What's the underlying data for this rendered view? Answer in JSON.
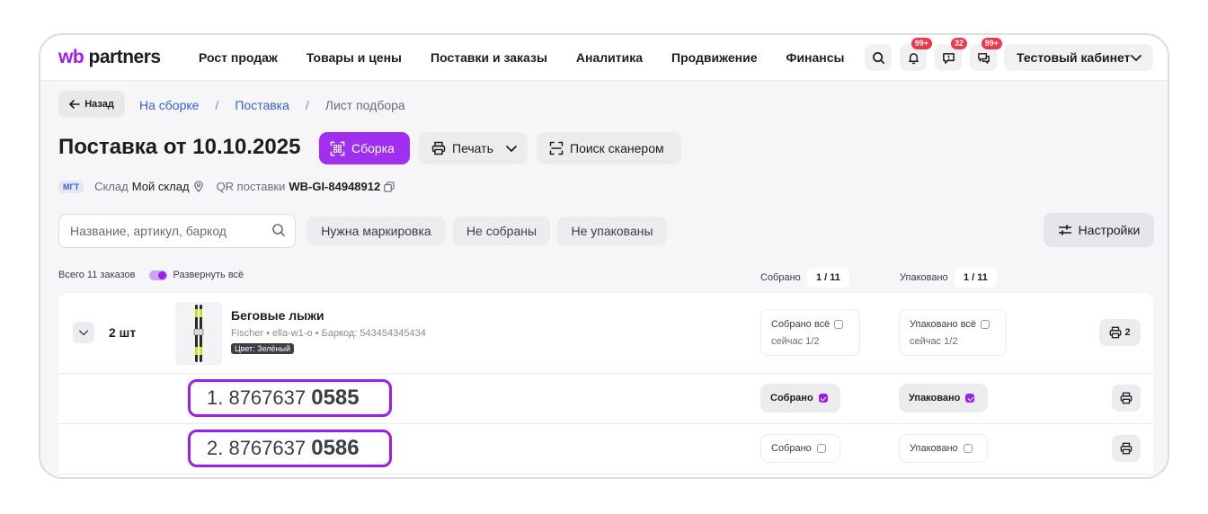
{
  "brand": {
    "wb": "wb",
    "partners": "partners"
  },
  "nav": [
    "Рост продаж",
    "Товары и цены",
    "Поставки и заказы",
    "Аналитика",
    "Продвижение",
    "Финансы"
  ],
  "badges": {
    "notifications": "99+",
    "feedback": "32",
    "chats": "99+"
  },
  "account": {
    "label": "Тестовый кабинет"
  },
  "back_label": "Назад",
  "breadcrumbs": {
    "c1": "На сборке",
    "c2": "Поставка",
    "c3": "Лист подбора",
    "sep": "/"
  },
  "page_title": "Поставка от 10.10.2025",
  "actions": {
    "assembly": "Сборка",
    "print": "Печать",
    "scanner": "Поиск сканером"
  },
  "meta": {
    "tag": "МГТ",
    "warehouse_label": "Склад",
    "warehouse_value": "Мой склад",
    "qr_label": "QR поставки",
    "qr_value": "WB-GI-84948912"
  },
  "search": {
    "placeholder": "Название, артикул, баркод"
  },
  "filters": [
    "Нужна маркировка",
    "Не собраны",
    "Не упакованы"
  ],
  "settings_label": "Настройки",
  "summary": {
    "total": "Всего 11 заказов",
    "expand": "Развернуть всё"
  },
  "counts": {
    "collected_label": "Собрано",
    "collected_value": "1 / 11",
    "packed_label": "Упаковано",
    "packed_value": "1 / 11"
  },
  "product": {
    "qty": "2 шт",
    "name": "Беговые лыжи",
    "sub": "Fischer • ella-w1-o • Баркод: 543454345434",
    "color": "Цвет: Зелёный",
    "collected_all": "Собрано всё",
    "collected_now": "сейчас 1/2",
    "packed_all": "Упаковано всё",
    "packed_now": "сейчас 1/2",
    "print_count": "2"
  },
  "items": [
    {
      "prefix": "1. 8767637",
      "suffix": "0585",
      "collected": "Собрано",
      "packed": "Упаковано",
      "collected_checked": true,
      "packed_checked": true
    },
    {
      "prefix": "2. 8767637",
      "suffix": "0586",
      "collected": "Собрано",
      "packed": "Упаковано",
      "collected_checked": false,
      "packed_checked": false
    }
  ],
  "colors": {
    "accent": "#9b1fe8",
    "badge": "#f0364a",
    "link": "#3a5fd9"
  }
}
